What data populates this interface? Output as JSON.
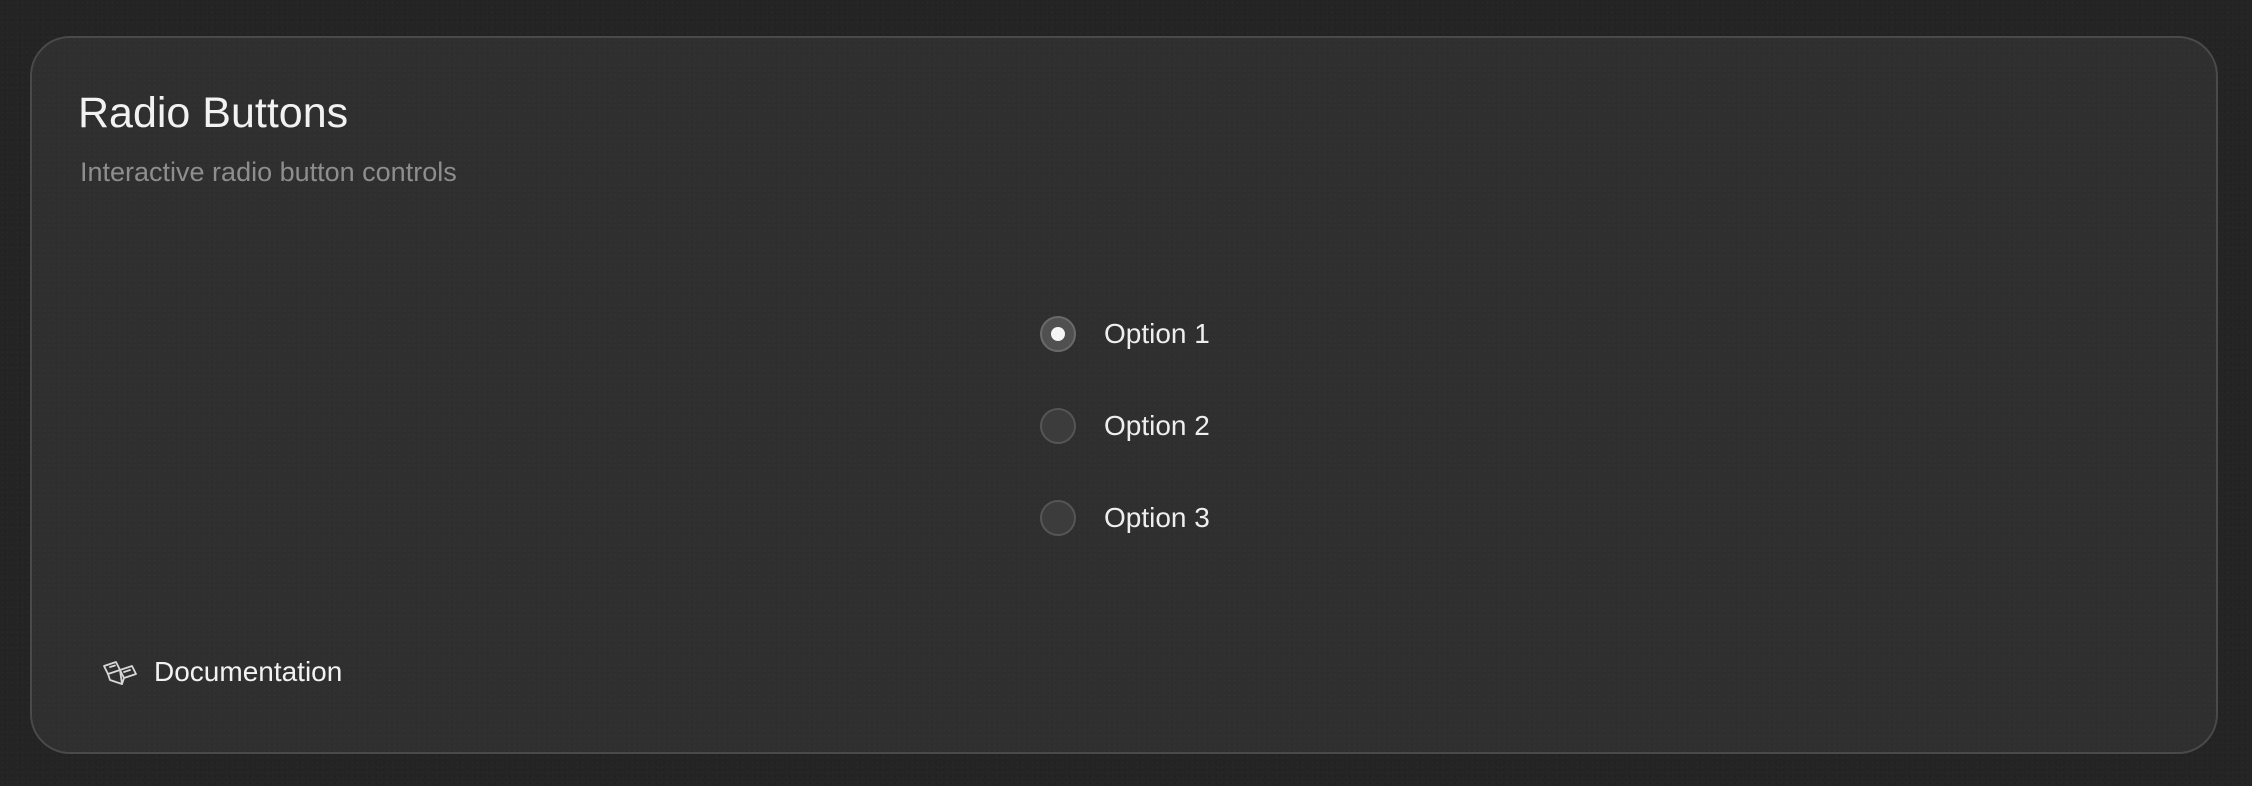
{
  "card": {
    "title": "Radio Buttons",
    "subtitle": "Interactive radio button controls"
  },
  "radio_group": {
    "selected_index": 0,
    "options": [
      {
        "label": "Option 1",
        "checked": true
      },
      {
        "label": "Option 2",
        "checked": false
      },
      {
        "label": "Option 3",
        "checked": false
      }
    ]
  },
  "footer": {
    "documentation_label": "Documentation",
    "documentation_icon": "open-book-icon"
  },
  "colors": {
    "page_background": "#242424",
    "card_background": "#2f2f2f",
    "card_border": "#4a4a4a",
    "title_text": "#f2f2f2",
    "subtitle_text": "#8e8e8e",
    "radio_dot": "#f5f5f5"
  }
}
